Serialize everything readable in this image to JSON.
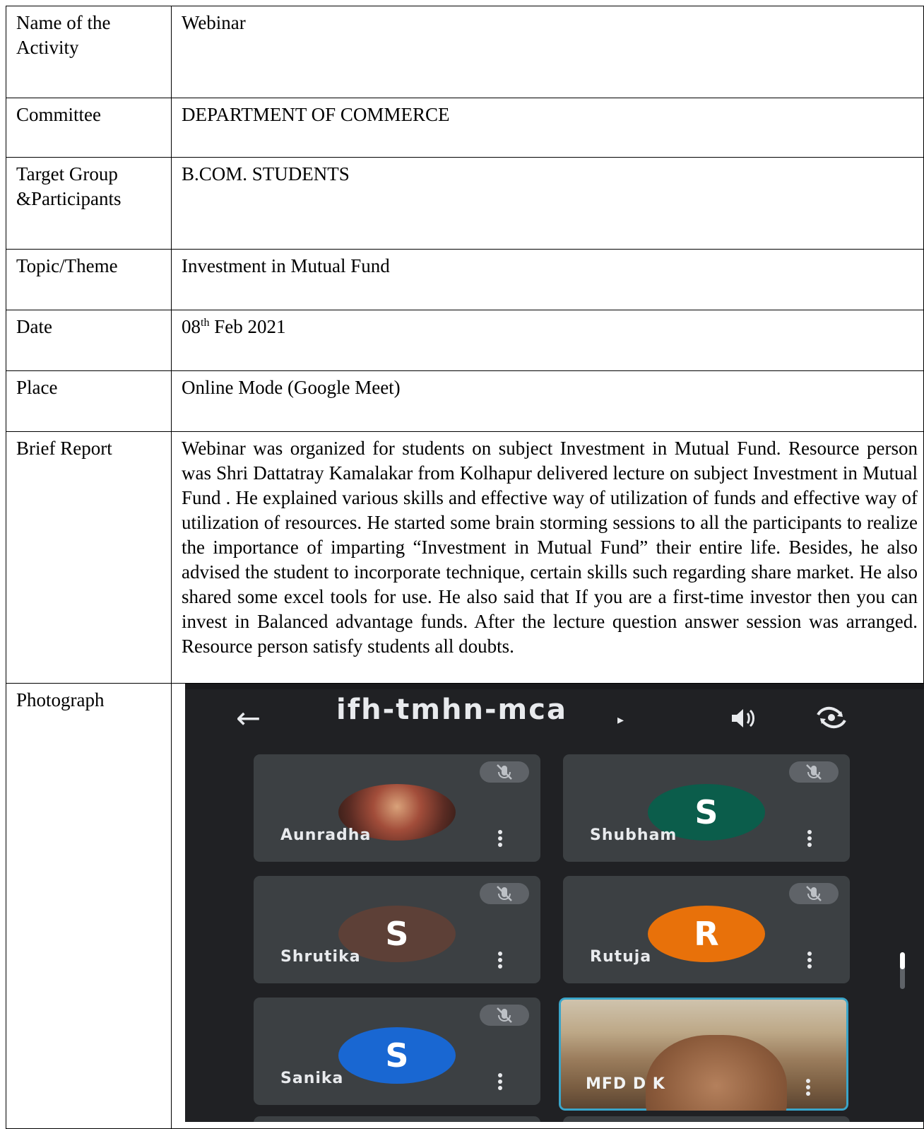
{
  "rows": [
    {
      "label": "Name of the Activity",
      "value": "Webinar"
    },
    {
      "label": "Committee",
      "value": "DEPARTMENT OF COMMERCE"
    },
    {
      "label": "Target Group &Participants",
      "value": "B.COM. STUDENTS"
    },
    {
      "label": "Topic/Theme",
      "value": "Investment in Mutual Fund"
    },
    {
      "label": "Date",
      "value_day": "08",
      "value_sup": "th",
      "value_rest": " Feb 2021"
    },
    {
      "label": "Place",
      "value": "Online Mode (Google Meet)"
    },
    {
      "label": "Brief Report",
      "value": "Webinar was organized for students on subject Investment in Mutual Fund. Resource person was Shri Dattatray Kamalakar from Kolhapur delivered lecture on subject Investment in Mutual Fund . He explained various skills and effective way of utilization of funds and effective way of utilization of resources. He started some brain storming sessions to all the participants to realize the importance of imparting “Investment in Mutual Fund” their entire life. Besides, he also advised the student to incorporate technique, certain skills such regarding share market. He also shared some excel tools for use.  He also said that If you are a first-time investor then you can invest in Balanced advantage funds. After the lecture question answer session was arranged. Resource person satisfy students all doubts."
    },
    {
      "label": "Photograph"
    }
  ],
  "meet": {
    "meeting_code": "ifh-tmhn-mca",
    "icons": {
      "back": "arrow-left-icon",
      "speaker": "speaker-icon",
      "switch_camera": "switch-camera-icon",
      "mic_off": "mic-off-icon",
      "more": "more-vert-icon"
    },
    "participants": [
      {
        "name": "Aunradha",
        "initial": "",
        "avatar_color": "#6b4a3a",
        "muted": true
      },
      {
        "name": "Shubham",
        "initial": "S",
        "avatar_color": "#0b5d4b",
        "muted": true
      },
      {
        "name": "Shrutika",
        "initial": "S",
        "avatar_color": "#5d4037",
        "muted": true
      },
      {
        "name": "Rutuja",
        "initial": "R",
        "avatar_color": "#e8710a",
        "muted": true
      },
      {
        "name": "Sanika",
        "initial": "S",
        "avatar_color": "#1967d2",
        "muted": true
      },
      {
        "name": "MFD D K",
        "initial": "",
        "avatar_color": "",
        "muted": false
      }
    ]
  }
}
